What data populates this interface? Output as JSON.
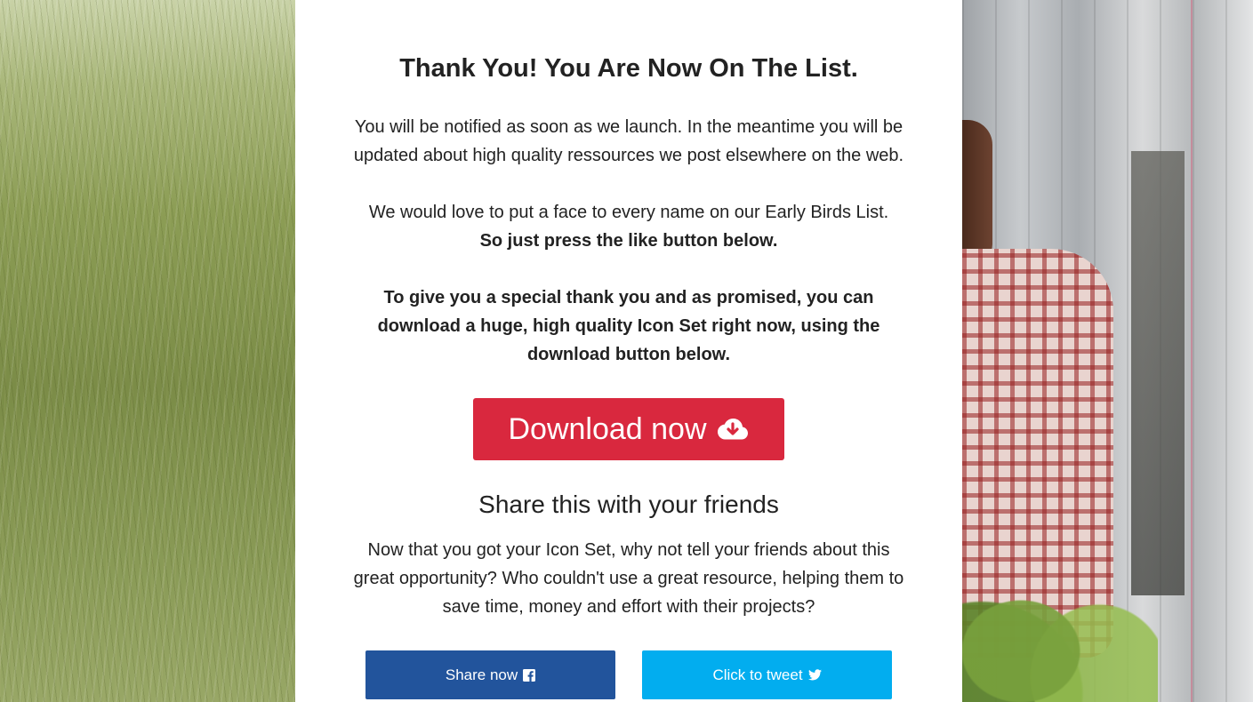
{
  "card": {
    "title": "Thank You! You Are Now On The List.",
    "paragraph1": "You will be notified as soon as we launch. In the meantime you will be updated about high quality ressources we post elsewhere on the web.",
    "paragraph2_line1": "We would love to put a face to every name on our Early Birds List.",
    "paragraph2_line2": "So just press the like button below.",
    "paragraph3": "To give you a special thank you and as promised, you can download a huge, high quality Icon Set right now, using the download button below.",
    "download_button": {
      "label": "Download now",
      "icon": "cloud-download-icon",
      "color": "#d9283e"
    },
    "share_heading": "Share this with your friends",
    "paragraph4": "Now that you got your Icon Set, why not tell your friends about this great opportunity? Who couldn't use a great resource, helping them to save time, money and effort with their projects?",
    "facebook_button": {
      "label": "Share now",
      "icon": "facebook-icon",
      "color": "#22549c"
    },
    "twitter_button": {
      "label": "Click to tweet",
      "icon": "twitter-icon",
      "color": "#02adef"
    }
  }
}
